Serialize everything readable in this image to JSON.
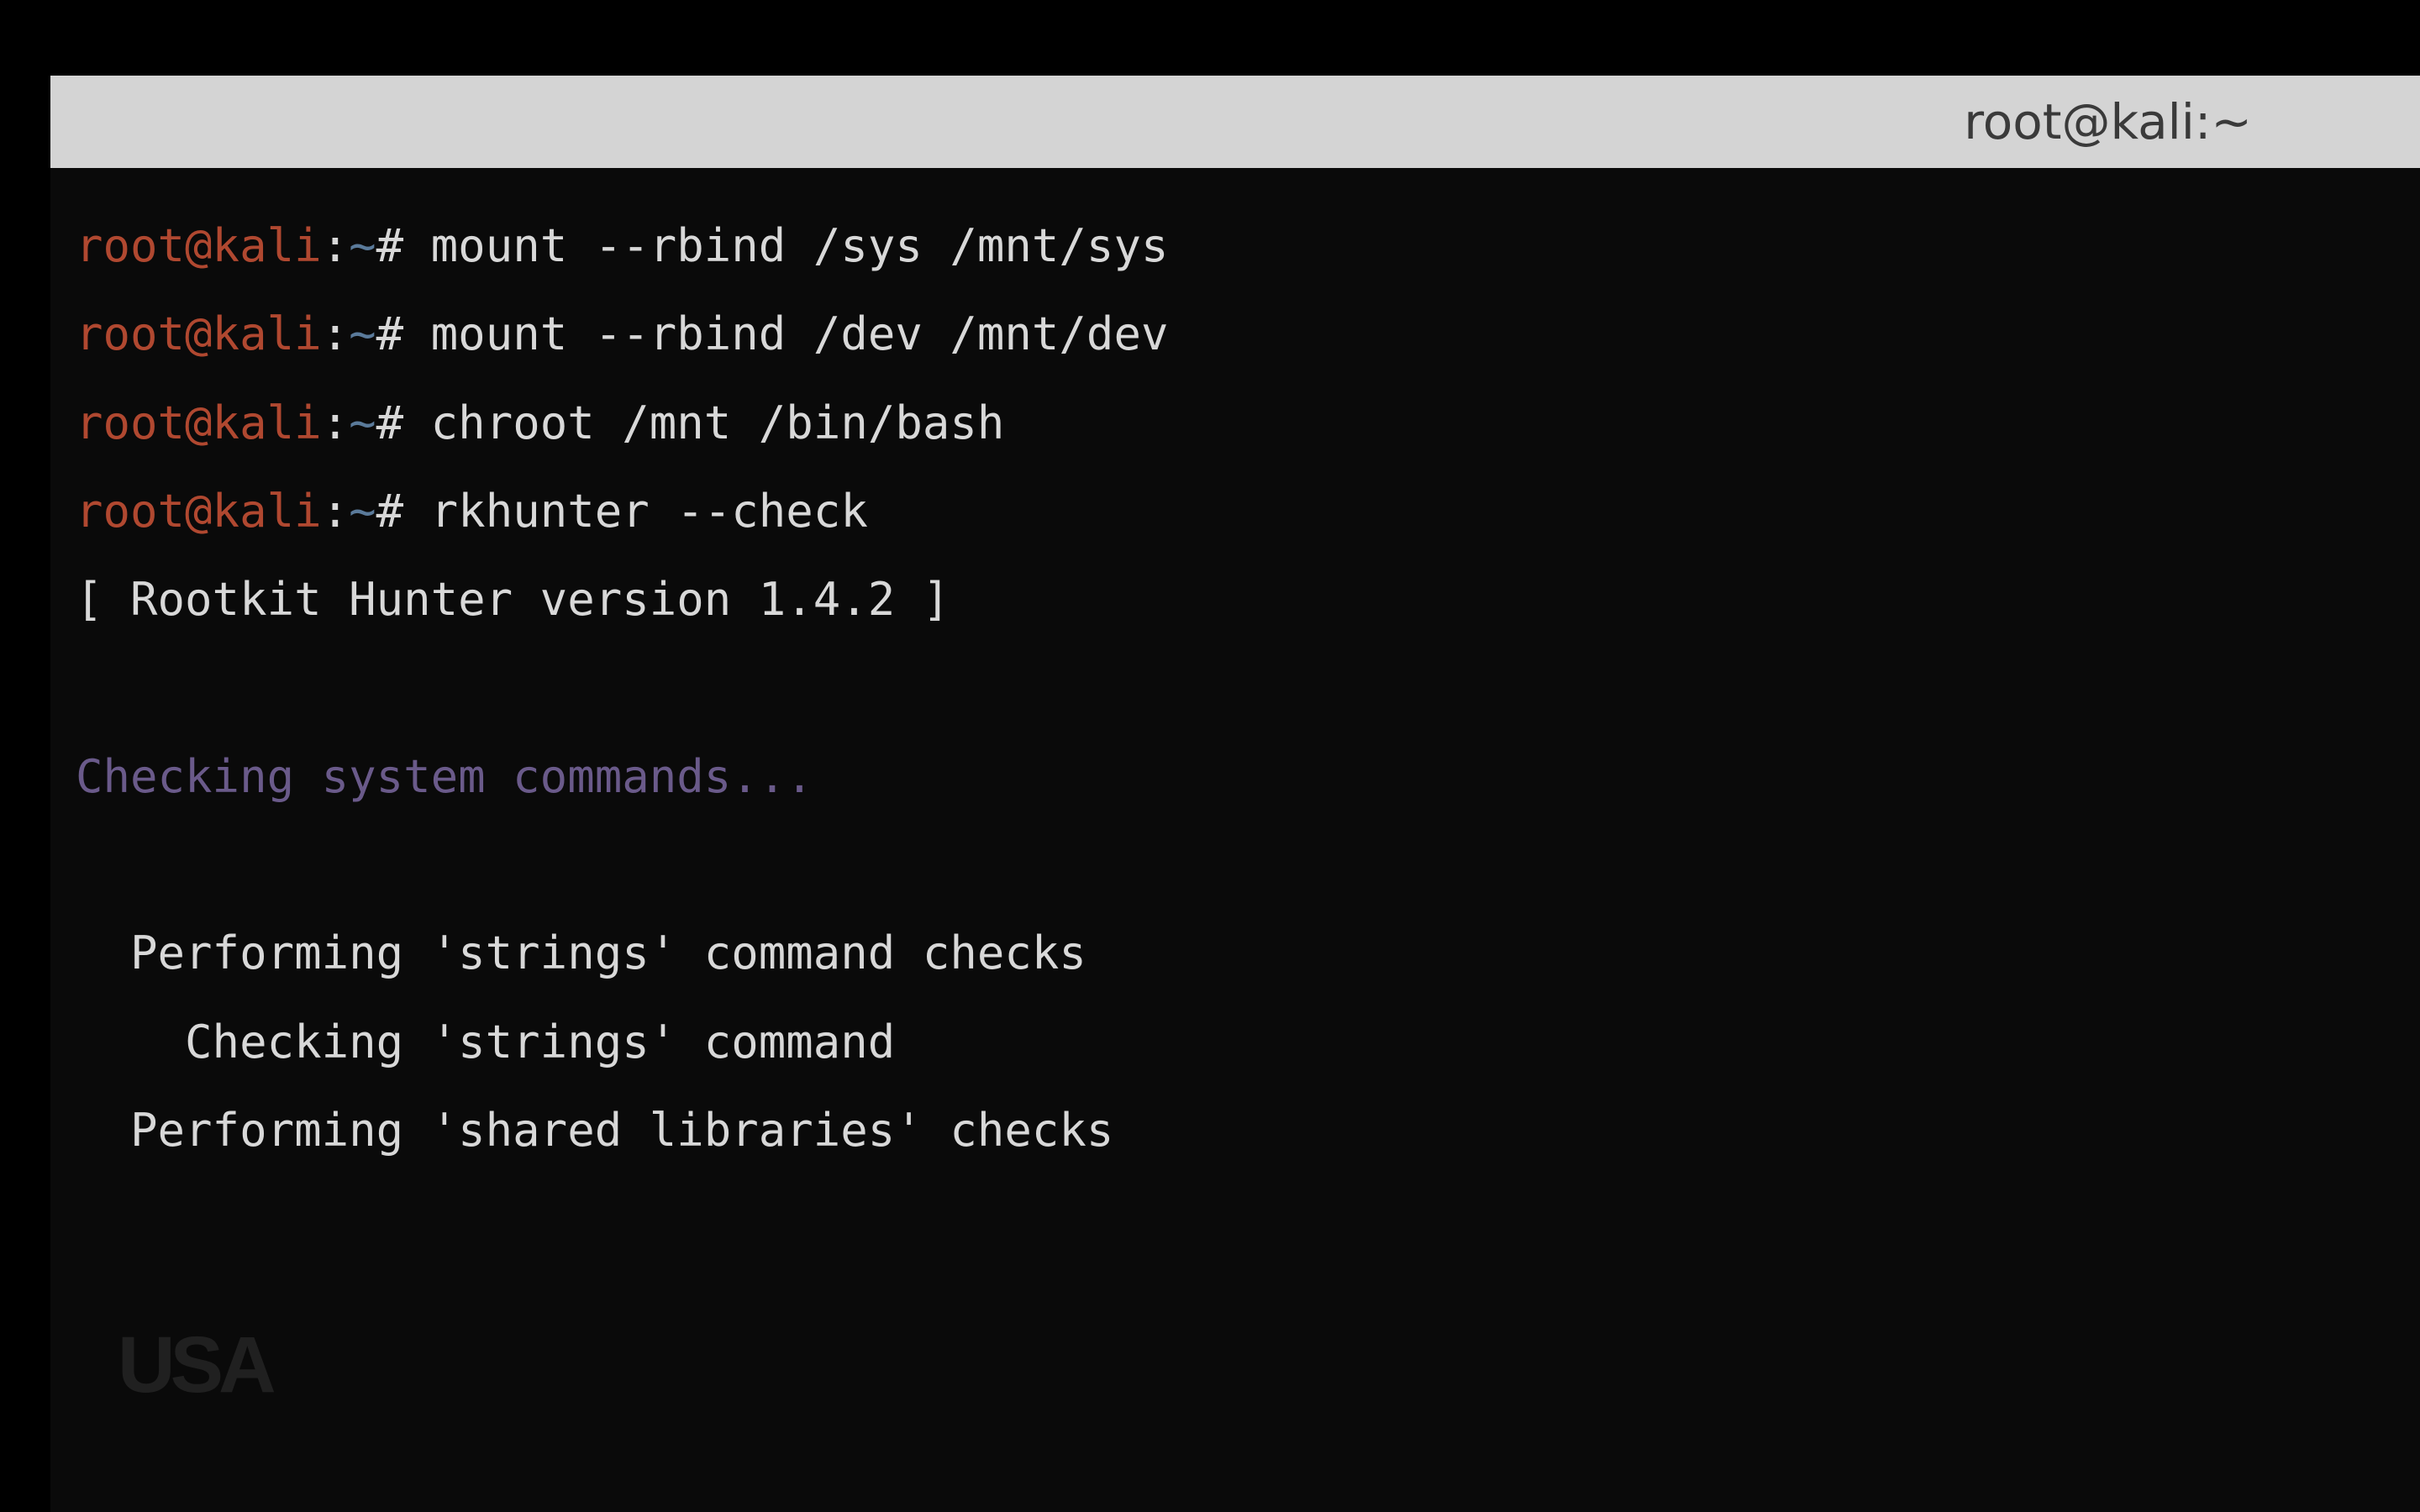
{
  "window": {
    "title": "root@kali:~"
  },
  "prompt": {
    "user_host": "root@kali",
    "colon": ":",
    "path": "~",
    "symbol": "#"
  },
  "commands": [
    "mount --rbind /sys /mnt/sys",
    "mount --rbind /dev /mnt/dev",
    "chroot /mnt /bin/bash",
    "rkhunter --check"
  ],
  "output": {
    "version_line": "[ Rootkit Hunter version 1.4.2 ]",
    "section_header": "Checking system commands...",
    "check_lines": [
      "  Performing 'strings' command checks",
      "    Checking 'strings' command",
      "",
      "  Performing 'shared libraries' checks"
    ]
  },
  "watermark": "USA"
}
